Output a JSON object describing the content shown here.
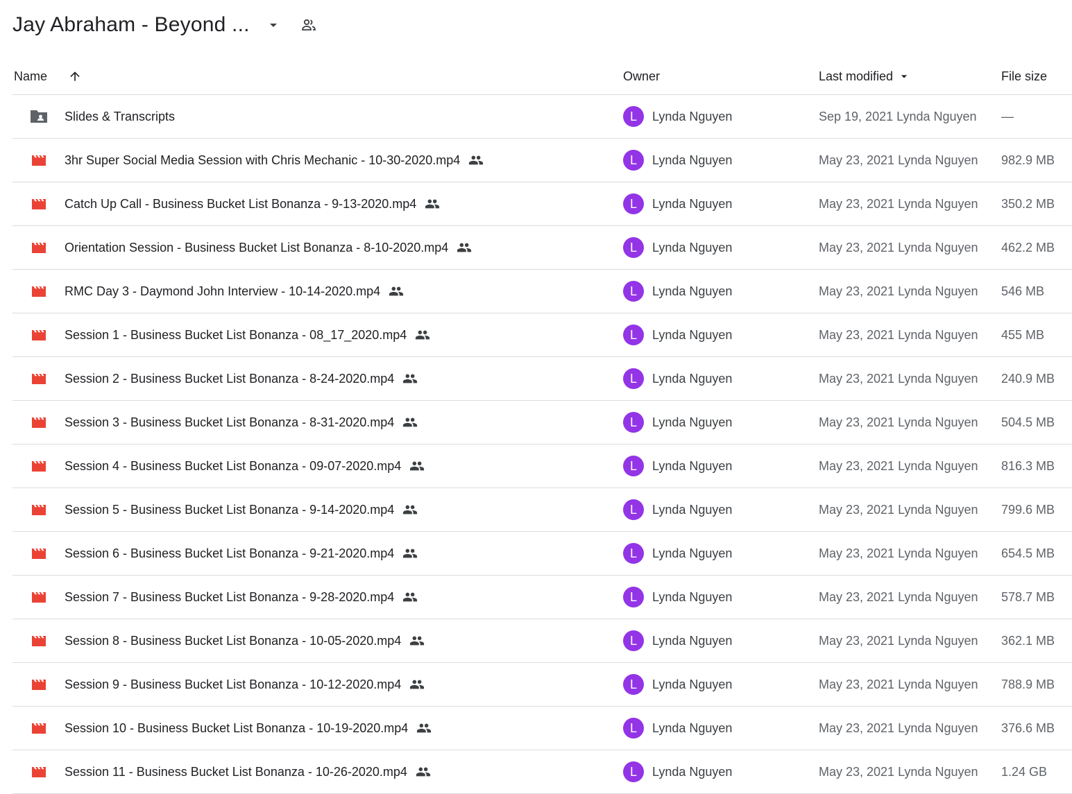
{
  "header": {
    "folder_title": "Jay Abraham - Beyond ...",
    "icons": {
      "dropdown": "arrow-drop-down-icon",
      "shared": "people-outline-icon"
    }
  },
  "columns": {
    "name": "Name",
    "owner": "Owner",
    "modified": "Last modified",
    "size": "File size"
  },
  "colors": {
    "video_icon": "#ea4335",
    "folder_icon": "#5f6368",
    "avatar": "#9334e6"
  },
  "files": [
    {
      "type": "folder",
      "name": "Slides & Transcripts",
      "shared": false,
      "owner_initial": "L",
      "owner": "Lynda Nguyen",
      "modified": "Sep 19, 2021 Lynda Nguyen",
      "size": "—"
    },
    {
      "type": "video",
      "name": "3hr Super Social Media Session with Chris Mechanic - 10-30-2020.mp4",
      "shared": true,
      "owner_initial": "L",
      "owner": "Lynda Nguyen",
      "modified": "May 23, 2021 Lynda Nguyen",
      "size": "982.9 MB"
    },
    {
      "type": "video",
      "name": "Catch Up Call - Business Bucket List Bonanza - 9-13-2020.mp4",
      "shared": true,
      "owner_initial": "L",
      "owner": "Lynda Nguyen",
      "modified": "May 23, 2021 Lynda Nguyen",
      "size": "350.2 MB"
    },
    {
      "type": "video",
      "name": "Orientation Session - Business Bucket List Bonanza - 8-10-2020.mp4",
      "shared": true,
      "owner_initial": "L",
      "owner": "Lynda Nguyen",
      "modified": "May 23, 2021 Lynda Nguyen",
      "size": "462.2 MB"
    },
    {
      "type": "video",
      "name": "RMC Day 3 - Daymond John Interview - 10-14-2020.mp4",
      "shared": true,
      "owner_initial": "L",
      "owner": "Lynda Nguyen",
      "modified": "May 23, 2021 Lynda Nguyen",
      "size": "546 MB"
    },
    {
      "type": "video",
      "name": "Session 1 - Business Bucket List Bonanza - 08_17_2020.mp4",
      "shared": true,
      "owner_initial": "L",
      "owner": "Lynda Nguyen",
      "modified": "May 23, 2021 Lynda Nguyen",
      "size": "455 MB"
    },
    {
      "type": "video",
      "name": "Session 2 - Business Bucket List Bonanza - 8-24-2020.mp4",
      "shared": true,
      "owner_initial": "L",
      "owner": "Lynda Nguyen",
      "modified": "May 23, 2021 Lynda Nguyen",
      "size": "240.9 MB"
    },
    {
      "type": "video",
      "name": "Session 3 - Business Bucket List Bonanza - 8-31-2020.mp4",
      "shared": true,
      "owner_initial": "L",
      "owner": "Lynda Nguyen",
      "modified": "May 23, 2021 Lynda Nguyen",
      "size": "504.5 MB"
    },
    {
      "type": "video",
      "name": "Session 4 - Business Bucket List Bonanza - 09-07-2020.mp4",
      "shared": true,
      "owner_initial": "L",
      "owner": "Lynda Nguyen",
      "modified": "May 23, 2021 Lynda Nguyen",
      "size": "816.3 MB"
    },
    {
      "type": "video",
      "name": "Session 5 - Business Bucket List Bonanza - 9-14-2020.mp4",
      "shared": true,
      "owner_initial": "L",
      "owner": "Lynda Nguyen",
      "modified": "May 23, 2021 Lynda Nguyen",
      "size": "799.6 MB"
    },
    {
      "type": "video",
      "name": "Session 6 - Business Bucket List Bonanza - 9-21-2020.mp4",
      "shared": true,
      "owner_initial": "L",
      "owner": "Lynda Nguyen",
      "modified": "May 23, 2021 Lynda Nguyen",
      "size": "654.5 MB"
    },
    {
      "type": "video",
      "name": "Session 7 - Business Bucket List Bonanza - 9-28-2020.mp4",
      "shared": true,
      "owner_initial": "L",
      "owner": "Lynda Nguyen",
      "modified": "May 23, 2021 Lynda Nguyen",
      "size": "578.7 MB"
    },
    {
      "type": "video",
      "name": "Session 8 - Business Bucket List Bonanza - 10-05-2020.mp4",
      "shared": true,
      "owner_initial": "L",
      "owner": "Lynda Nguyen",
      "modified": "May 23, 2021 Lynda Nguyen",
      "size": "362.1 MB"
    },
    {
      "type": "video",
      "name": "Session 9 - Business Bucket List Bonanza - 10-12-2020.mp4",
      "shared": true,
      "owner_initial": "L",
      "owner": "Lynda Nguyen",
      "modified": "May 23, 2021 Lynda Nguyen",
      "size": "788.9 MB"
    },
    {
      "type": "video",
      "name": "Session 10 - Business Bucket List Bonanza - 10-19-2020.mp4",
      "shared": true,
      "owner_initial": "L",
      "owner": "Lynda Nguyen",
      "modified": "May 23, 2021 Lynda Nguyen",
      "size": "376.6 MB"
    },
    {
      "type": "video",
      "name": "Session 11 - Business Bucket List Bonanza - 10-26-2020.mp4",
      "shared": true,
      "owner_initial": "L",
      "owner": "Lynda Nguyen",
      "modified": "May 23, 2021 Lynda Nguyen",
      "size": "1.24 GB"
    }
  ]
}
